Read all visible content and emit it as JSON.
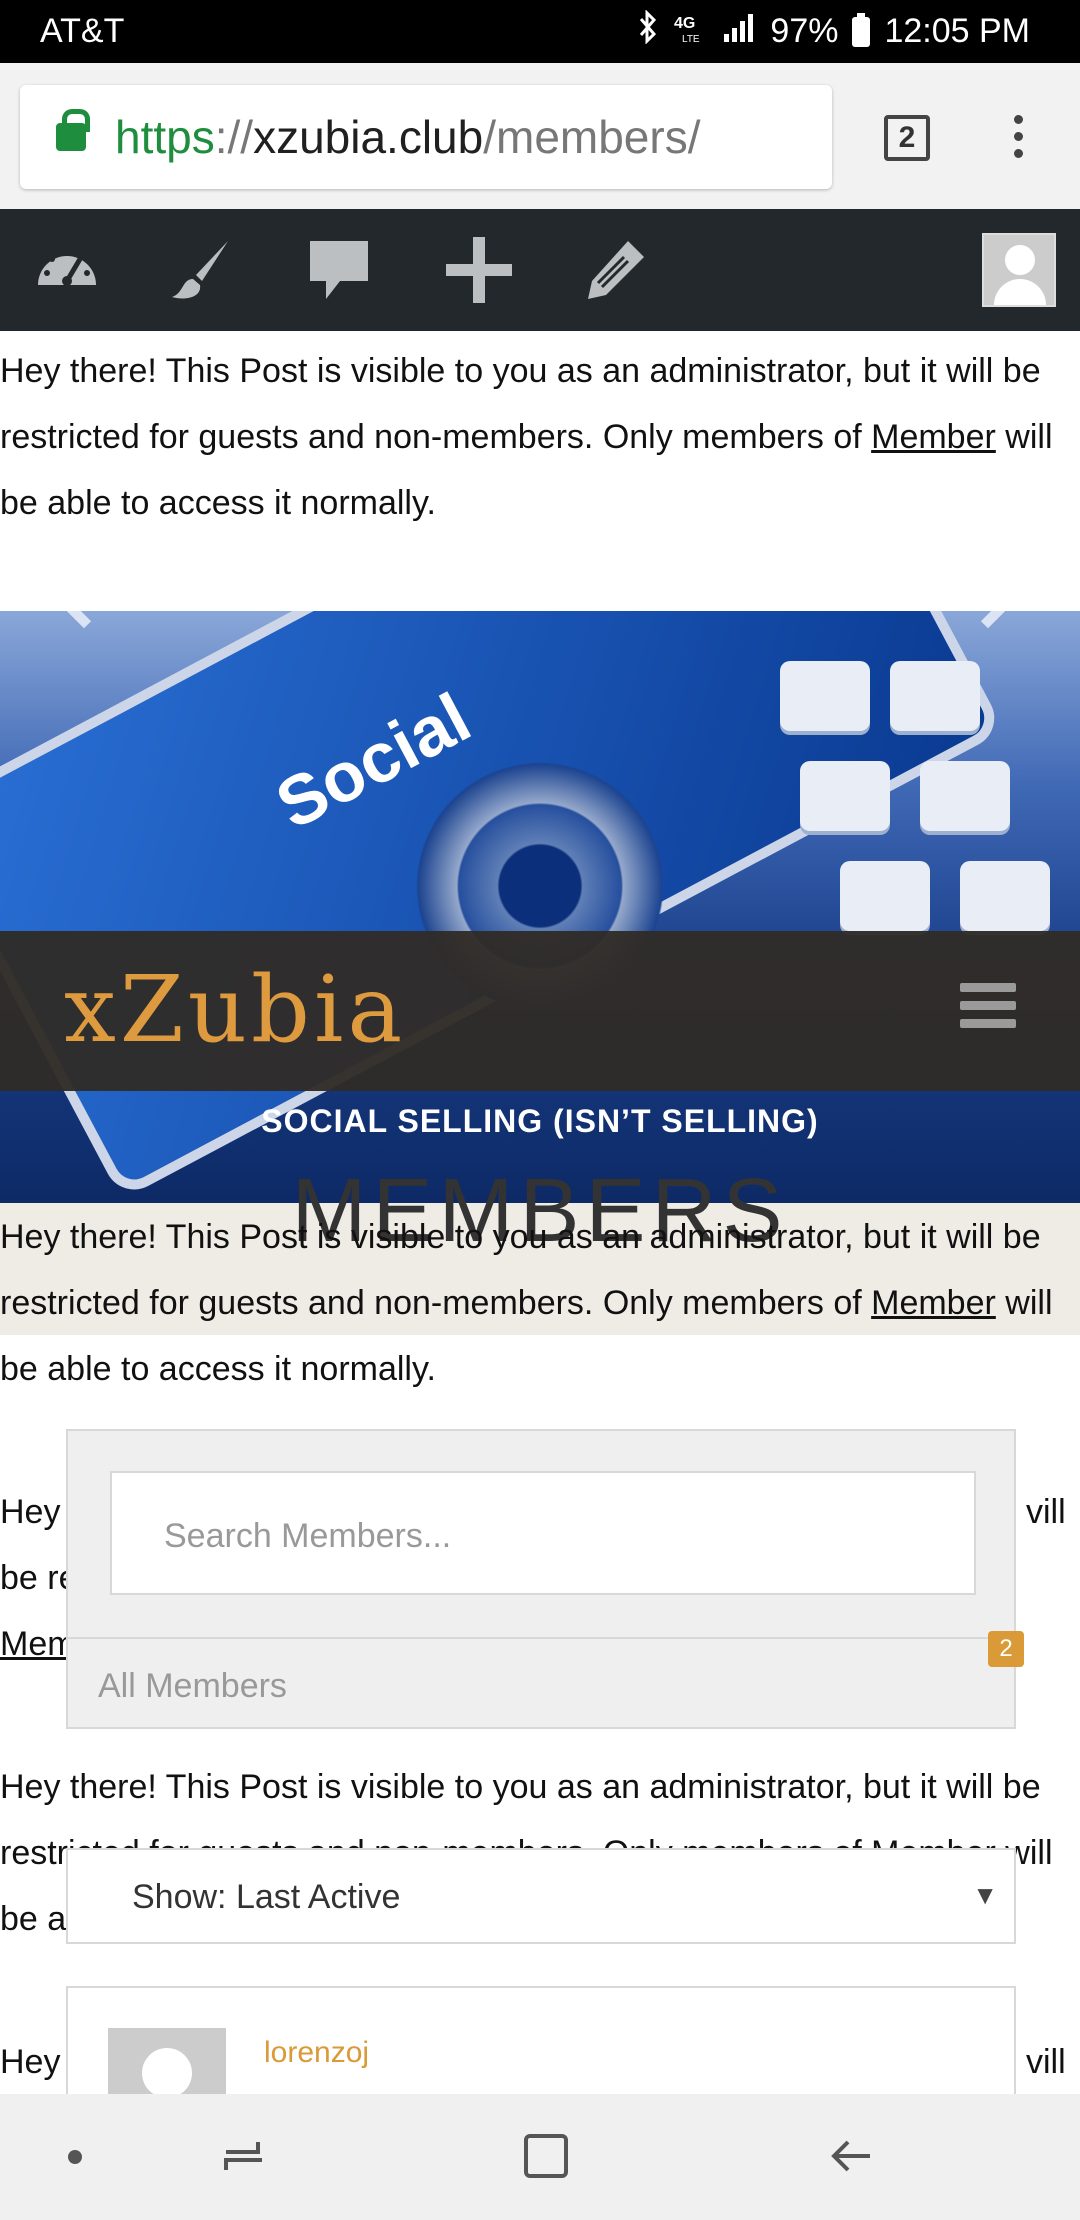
{
  "status_bar": {
    "carrier": "AT&T",
    "network": "4G LTE",
    "battery": "97%",
    "time": "12:05 PM"
  },
  "browser": {
    "url_scheme": "https",
    "url_separator": "://",
    "url_host": "xzubia.club",
    "url_path": "/members/",
    "tab_count": "2"
  },
  "admin_bar": {
    "icons": [
      "dashboard-icon",
      "customize-icon",
      "comments-icon",
      "new-content-icon",
      "edit-icon",
      "user-avatar"
    ]
  },
  "notice": {
    "text_before": "Hey there! This Post is visible to you as an administrator, but it will be restricted for guests and non-members. Only members of",
    "link": "Member",
    "text_after": "will be able to access it normally."
  },
  "notice_partial": {
    "line1_start": "Hey",
    "line1_end": "vill",
    "line2_start": "be re",
    "line3_start": "Mem"
  },
  "hero": {
    "image_word": "Social",
    "site_title": "xZubia",
    "tagline": "SOCIAL SELLING (ISN’T SELLING)"
  },
  "page_title": "MEMBERS",
  "members": {
    "search_placeholder": "Search Members...",
    "tab_label": "All Members",
    "tab_count": "2",
    "order_select": "Show: Last Active",
    "first_member": "lorenzoj"
  },
  "colors": {
    "accent": "#dd9a3e",
    "admin_bar": "#23282d",
    "secure_green": "#1e8e3e"
  }
}
